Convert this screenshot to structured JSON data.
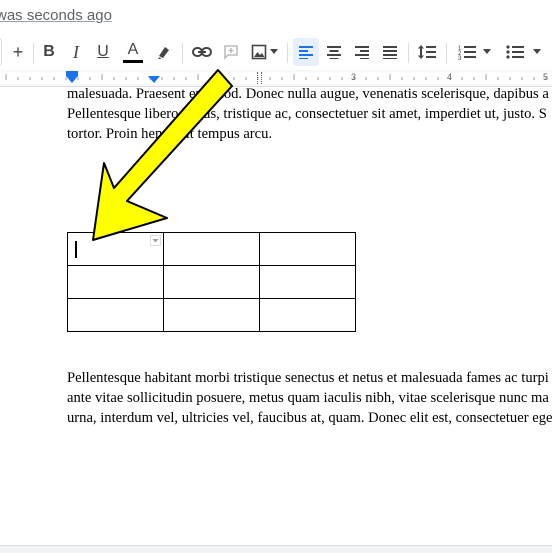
{
  "header": {
    "last_edit": "was seconds ago"
  },
  "toolbar": {
    "plus_label": "+",
    "bold_label": "B",
    "italic_label": "I",
    "underline_label": "U",
    "text_color_label": "A",
    "text_color_hex": "#000000",
    "accent_hex": "#1a73e8"
  },
  "ruler": {
    "numbers": [
      "3",
      "4",
      "5"
    ]
  },
  "document": {
    "para_top": [
      "malesuada. Praesent euismod. Donec nulla augue, venenatis scelerisque, dapibus a",
      "Pellentesque libero lectus, tristique ac, consectetuer sit amet, imperdiet ut, justo. S",
      "tortor. Proin hendrerit tempus arcu."
    ],
    "para_bottom": [
      "Pellentesque habitant morbi tristique senectus et netus et malesuada fames ac turpi",
      "ante vitae sollicitudin posuere, metus quam iaculis nibh, vitae scelerisque nunc ma",
      "urna, interdum vel, ultricies vel, faucibus at, quam. Donec elit est, consectetuer ege"
    ],
    "table": {
      "rows": 3,
      "cols": 3
    }
  },
  "annotation": {
    "arrow_color": "#ffff00"
  }
}
